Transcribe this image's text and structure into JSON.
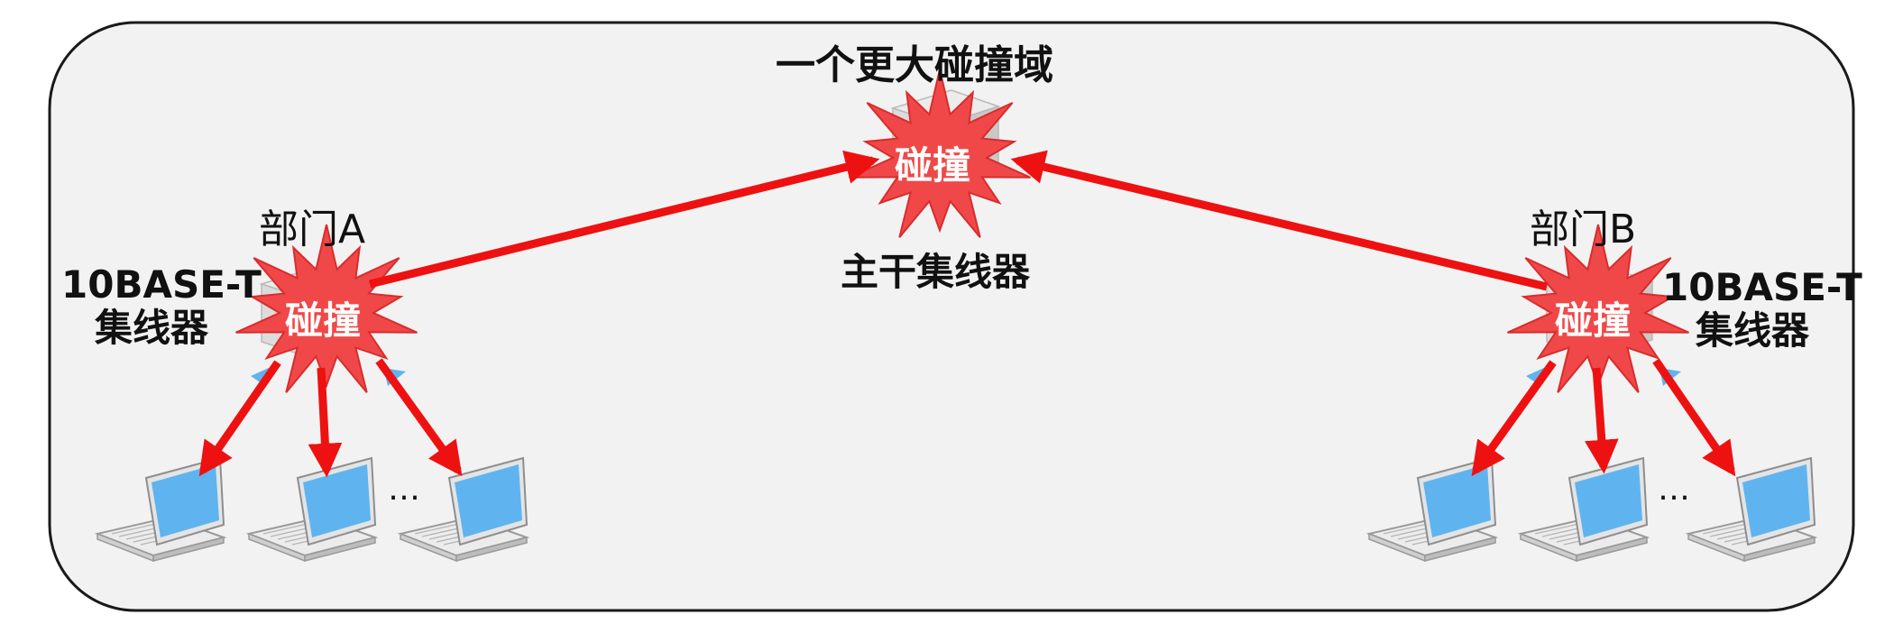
{
  "title": "一个更大碰撞域",
  "backbone_hub": {
    "label": "主干集线器",
    "collision_text": "碰撞"
  },
  "dept_a": {
    "name": "部门A",
    "hub_line1": "10BASE-T",
    "hub_line2": "集线器",
    "collision_text": "碰撞",
    "ellipsis": "…"
  },
  "dept_b": {
    "name": "部门B",
    "hub_line1": "10BASE-T",
    "hub_line2": "集线器",
    "collision_text": "碰撞",
    "ellipsis": "…"
  },
  "colors": {
    "arrow": "#ee1111",
    "burst": "#f04848",
    "laptop_screen": "#5fb4ef",
    "panel": "#f2f2f2"
  }
}
